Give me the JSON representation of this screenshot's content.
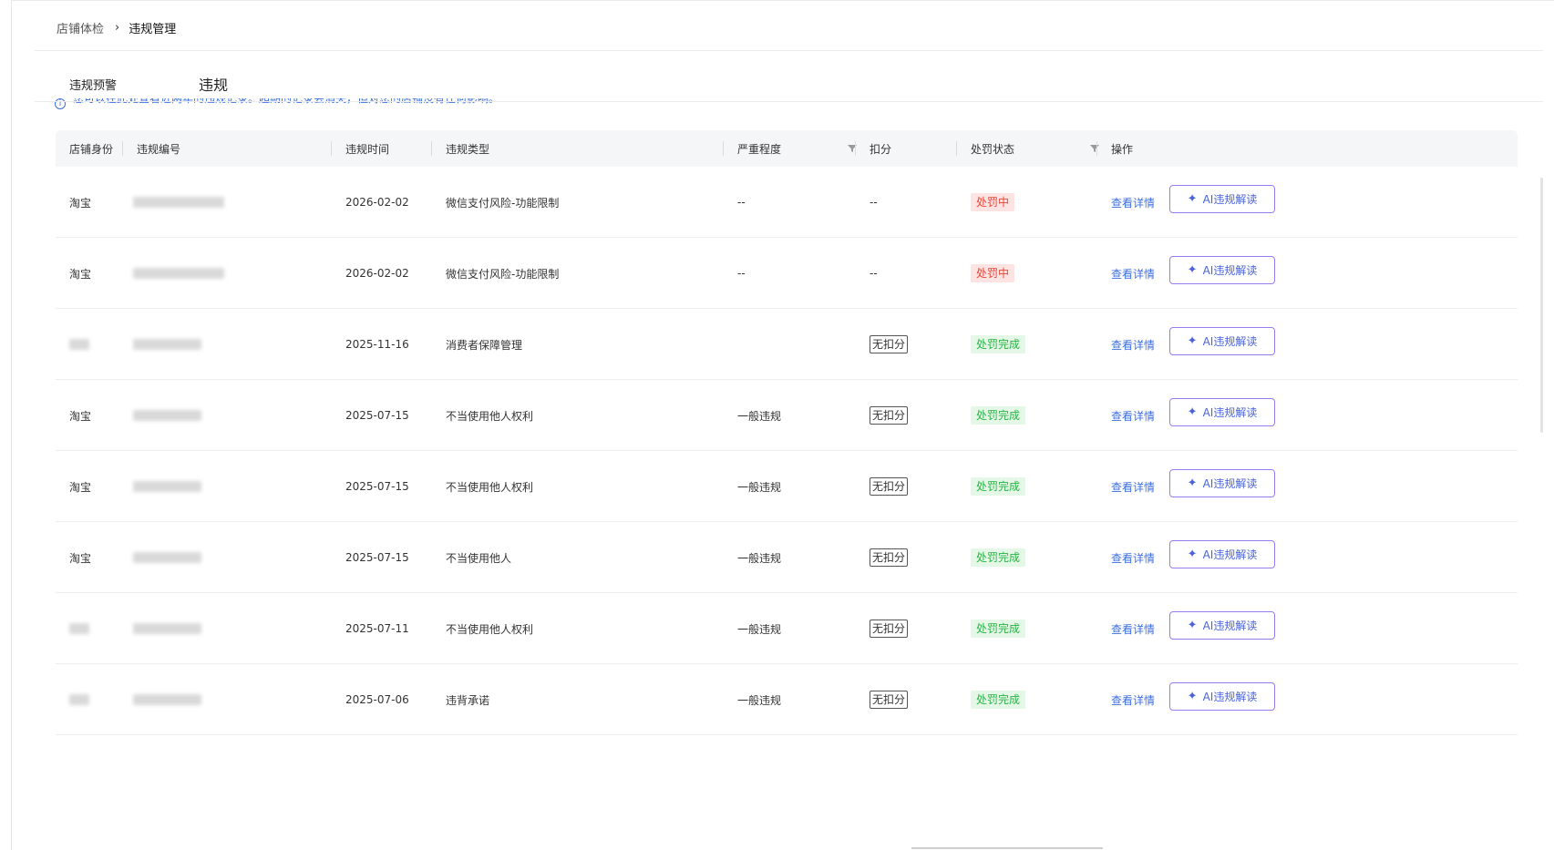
{
  "breadcrumb": {
    "parent": "店铺体检",
    "separator": "›",
    "current": "违规管理"
  },
  "tabs": [
    {
      "label": "违规预警"
    },
    {
      "label": "违规"
    }
  ],
  "notice": {
    "icon": "info-icon",
    "text": "您可以在此处查看近两年的违规记录。超期的记录会消失，但对您的店铺没有任何影响。"
  },
  "table": {
    "columns": [
      "店铺身份",
      "违规编号",
      "违规时间",
      "违规类型",
      "严重程度",
      "扣分",
      "处罚状态",
      "操作"
    ],
    "rows": [
      {
        "shop": "淘宝",
        "time": "2026-02-02",
        "type": "微信支付风险-功能限制",
        "severity": "--",
        "deduction": "--",
        "status": "处罚中",
        "status_kind": "red",
        "detail": "查看详情",
        "ai": "AI违规解读"
      },
      {
        "shop": "淘宝",
        "time": "2026-02-02",
        "type": "微信支付风险-功能限制",
        "severity": "--",
        "deduction": "--",
        "status": "处罚中",
        "status_kind": "red",
        "detail": "查看详情",
        "ai": "AI违规解读"
      },
      {
        "shop": "",
        "time": "2025-11-16",
        "type": "消费者保障管理",
        "severity": "",
        "deduction": "无扣分",
        "status": "处罚完成",
        "status_kind": "green",
        "detail": "查看详情",
        "ai": "AI违规解读"
      },
      {
        "shop": "淘宝",
        "time": "2025-07-15",
        "type": "不当使用他人权利",
        "severity": "一般违规",
        "deduction": "无扣分",
        "status": "处罚完成",
        "status_kind": "green",
        "detail": "查看详情",
        "ai": "AI违规解读"
      },
      {
        "shop": "淘宝",
        "time": "2025-07-15",
        "type": "不当使用他人权利",
        "severity": "一般违规",
        "deduction": "无扣分",
        "status": "处罚完成",
        "status_kind": "green",
        "detail": "查看详情",
        "ai": "AI违规解读"
      },
      {
        "shop": "淘宝",
        "time": "2025-07-15",
        "type": "不当使用他人",
        "severity": "一般违规",
        "deduction": "无扣分",
        "status": "处罚完成",
        "status_kind": "green",
        "detail": "查看详情",
        "ai": "AI违规解读"
      },
      {
        "shop": "",
        "time": "2025-07-11",
        "type": "不当使用他人权利",
        "severity": "一般违规",
        "deduction": "无扣分",
        "status": "处罚完成",
        "status_kind": "green",
        "detail": "查看详情",
        "ai": "AI违规解读"
      },
      {
        "shop": "",
        "time": "2025-07-06",
        "type": "违背承诺",
        "severity": "一般违规",
        "deduction": "无扣分",
        "status": "处罚完成",
        "status_kind": "green",
        "detail": "查看详情",
        "ai": "AI违规解读"
      }
    ]
  },
  "icons": {
    "filter": "filter-icon",
    "ai_star": "sparkle-icon",
    "info": "info-icon"
  },
  "colors": {
    "link": "#3d6fe0",
    "red_tag_bg": "#fde3e1",
    "red_tag_text": "#e8463a",
    "green_tag_bg": "#e5f7e6",
    "green_tag_text": "#27b545",
    "ai_border": "#9a7cf0"
  }
}
